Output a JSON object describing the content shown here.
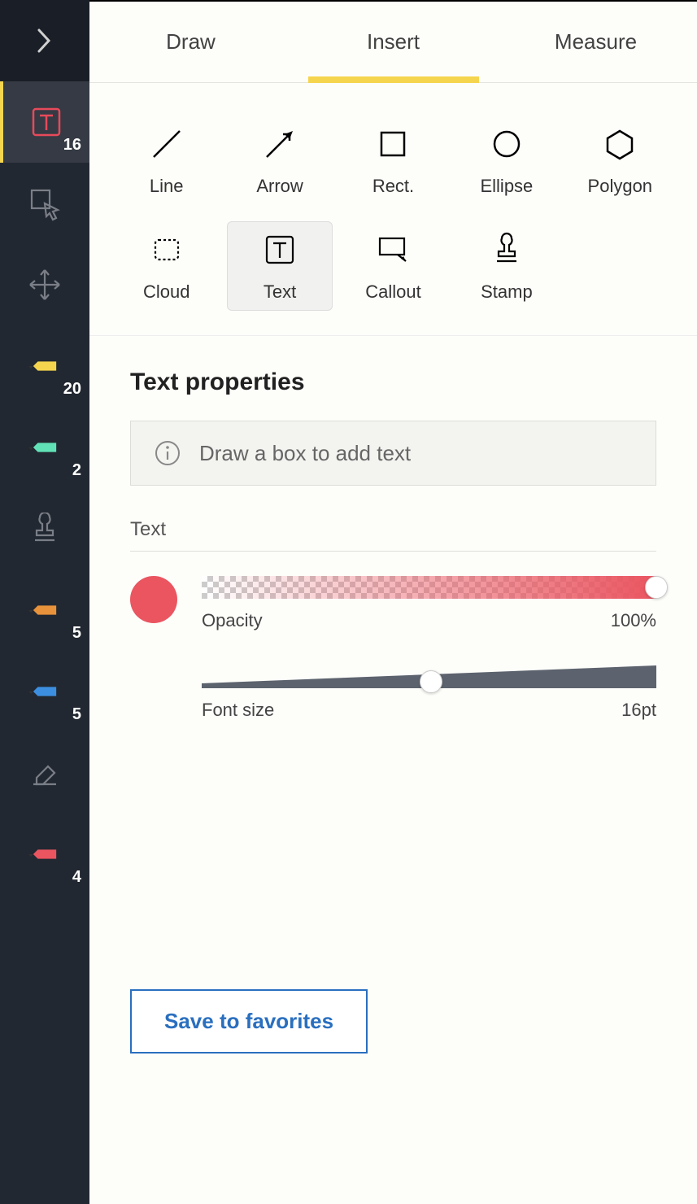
{
  "sidebar": {
    "items": [
      {
        "name": "expand",
        "badge": ""
      },
      {
        "name": "text-tool",
        "badge": "16",
        "active": true
      },
      {
        "name": "select-tool",
        "badge": ""
      },
      {
        "name": "pan-tool",
        "badge": ""
      },
      {
        "name": "pen-yellow",
        "badge": "20",
        "color": "#f5d54e"
      },
      {
        "name": "pen-mint",
        "badge": "2",
        "color": "#61e2b6"
      },
      {
        "name": "stamp-tool",
        "badge": ""
      },
      {
        "name": "pen-orange",
        "badge": "5",
        "color": "#e8923b"
      },
      {
        "name": "pen-blue",
        "badge": "5",
        "color": "#3c8fe0"
      },
      {
        "name": "eraser",
        "badge": ""
      },
      {
        "name": "pen-red",
        "badge": "4",
        "color": "#ea5560"
      }
    ]
  },
  "tabs": [
    {
      "label": "Draw",
      "active": false
    },
    {
      "label": "Insert",
      "active": true
    },
    {
      "label": "Measure",
      "active": false
    }
  ],
  "shapes": [
    {
      "label": "Line"
    },
    {
      "label": "Arrow"
    },
    {
      "label": "Rect."
    },
    {
      "label": "Ellipse"
    },
    {
      "label": "Polygon"
    },
    {
      "label": "Cloud"
    },
    {
      "label": "Text",
      "selected": true
    },
    {
      "label": "Callout"
    },
    {
      "label": "Stamp"
    }
  ],
  "properties": {
    "title": "Text properties",
    "hint": "Draw a box to add text",
    "section_label": "Text",
    "opacity_label": "Opacity",
    "opacity_value": "100%",
    "fontsize_label": "Font size",
    "fontsize_value": "16pt",
    "color": "#ea5560"
  },
  "actions": {
    "save_label": "Save to favorites"
  }
}
